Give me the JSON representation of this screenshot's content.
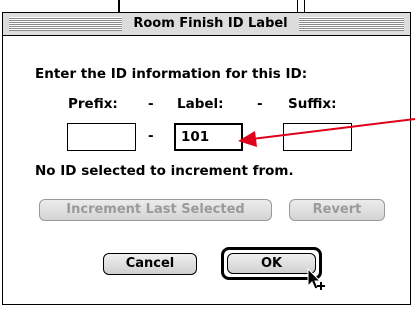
{
  "dialog": {
    "title": "Room Finish ID Label",
    "instruction": "Enter the ID information for this ID:",
    "prefix_label": "Prefix:",
    "label_label": "Label:",
    "suffix_label": "Suffix:",
    "separator": "-",
    "prefix_value": "",
    "label_value": "101",
    "suffix_value": "",
    "status": "No ID selected to increment from.",
    "increment_button": "Increment Last Selected",
    "revert_button": "Revert",
    "cancel_button": "Cancel",
    "ok_button": "OK"
  },
  "colors": {
    "annotation_arrow": "#e0001b"
  }
}
